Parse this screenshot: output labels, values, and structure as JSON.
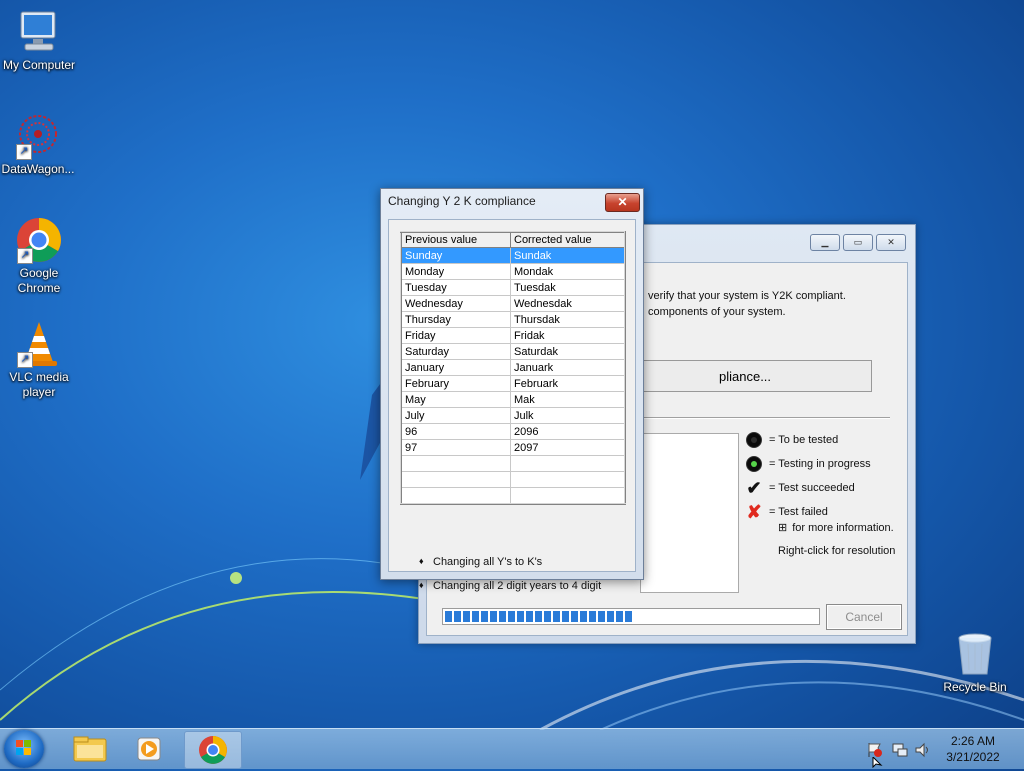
{
  "desktop": {
    "icons": [
      {
        "label": "My Computer"
      },
      {
        "label": "DataWagon..."
      },
      {
        "label": "Google Chrome"
      },
      {
        "label": "VLC media player"
      },
      {
        "label": "Recycle Bin"
      }
    ]
  },
  "dialog": {
    "title": "Changing Y 2 K compliance",
    "close_label": "✕",
    "columns": [
      "Previous value",
      "Corrected value"
    ],
    "rows": [
      [
        "Sunday",
        "Sundak"
      ],
      [
        "Monday",
        "Mondak"
      ],
      [
        "Tuesday",
        "Tuesdak"
      ],
      [
        "Wednesday",
        "Wednesdak"
      ],
      [
        "Thursday",
        "Thursdak"
      ],
      [
        "Friday",
        "Fridak"
      ],
      [
        "Saturday",
        "Saturdak"
      ],
      [
        "January",
        "Januark"
      ],
      [
        "February",
        "Februark"
      ],
      [
        "May",
        "Mak"
      ],
      [
        "July",
        "Julk"
      ],
      [
        "96",
        "2096"
      ],
      [
        "97",
        "2097"
      ],
      [
        "",
        ""
      ],
      [
        "",
        ""
      ],
      [
        "",
        ""
      ]
    ],
    "selected_row": 0,
    "notes": [
      "Changing all Y's to K's",
      "Changing all 2 digit years to 4 digit"
    ]
  },
  "main_window": {
    "intro_line1": "verify that your system is Y2K compliant.",
    "intro_line2": "components of your system.",
    "check_button": "pliance...",
    "legend": {
      "to_be_tested": "= To be tested",
      "in_progress": "= Testing in progress",
      "succeeded": "= Test succeeded",
      "failed": "= Test failed",
      "more_info": "for more information.",
      "expand_symbol": "⊞",
      "right_click": "Right-click for resolution"
    },
    "progress_fraction": 0.51,
    "cancel_label": "Cancel"
  },
  "taskbar": {
    "clock_time": "2:26 AM",
    "clock_date": "3/21/2022"
  }
}
